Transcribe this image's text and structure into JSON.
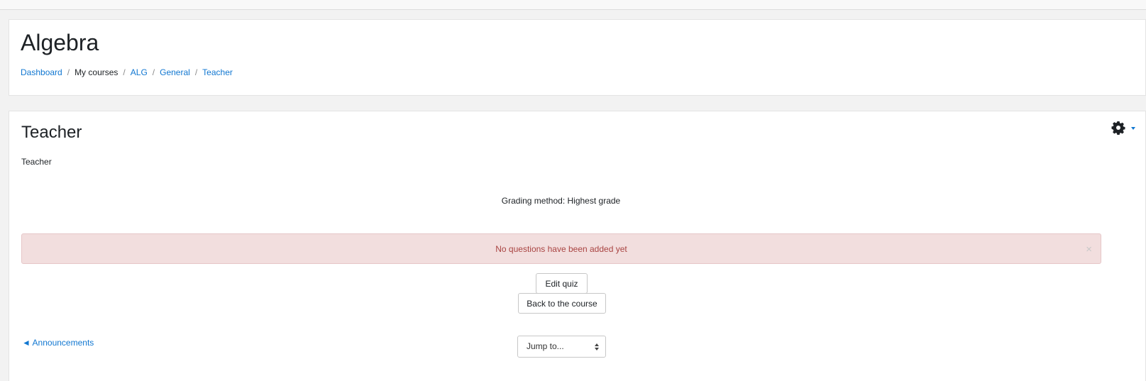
{
  "page": {
    "course_title": "Algebra",
    "breadcrumb": [
      {
        "label": "Dashboard",
        "link": true
      },
      {
        "label": "My courses",
        "link": false
      },
      {
        "label": "ALG",
        "link": true
      },
      {
        "label": "General",
        "link": true
      },
      {
        "label": "Teacher",
        "link": true
      }
    ]
  },
  "activity": {
    "title": "Teacher",
    "intro": "Teacher",
    "grading_method": "Grading method: Highest grade",
    "alert": {
      "message": "No questions have been added yet",
      "close_icon": "×"
    },
    "buttons": {
      "edit": "Edit quiz",
      "back": "Back to the course"
    },
    "navigation": {
      "previous": "◄ Announcements",
      "jump_to": "Jump to..."
    },
    "settings_icon": "gear-icon"
  },
  "colors": {
    "link": "#1177d1",
    "alert_background": "#f2dede",
    "alert_text": "#a94442"
  }
}
